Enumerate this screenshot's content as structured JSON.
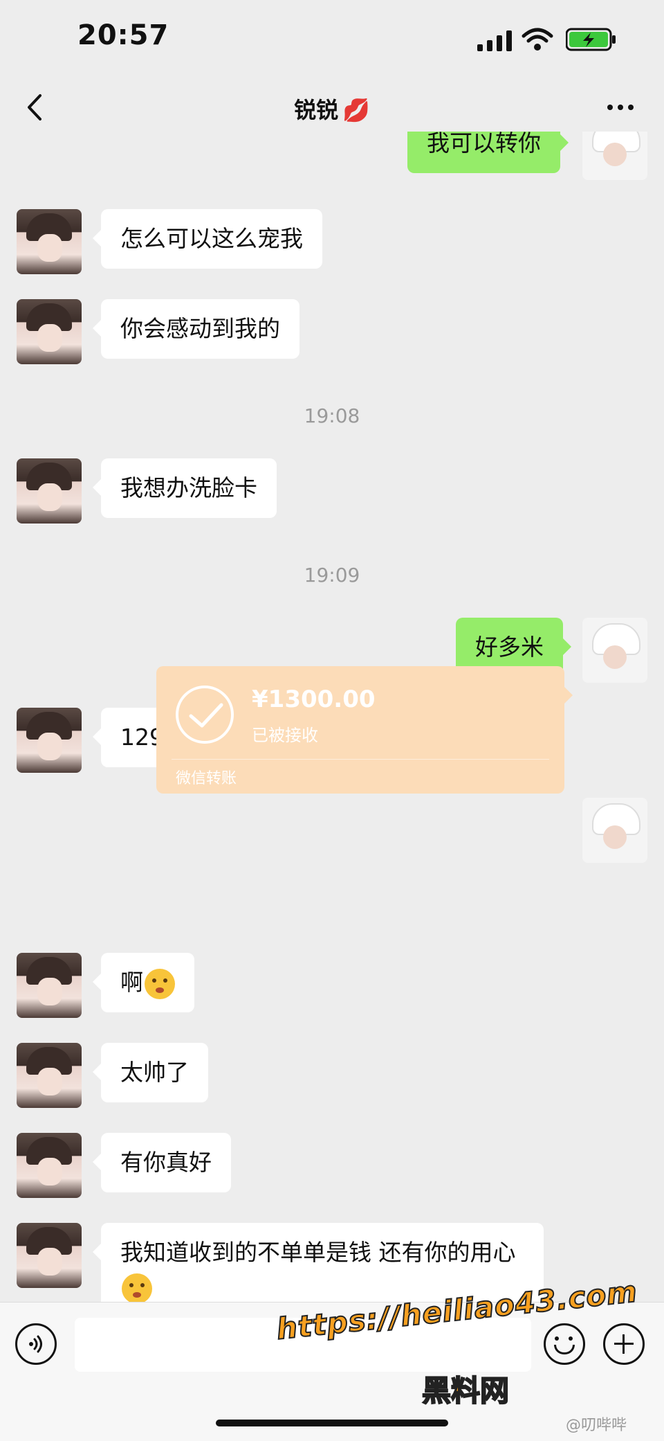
{
  "status_bar": {
    "time": "20:57"
  },
  "header": {
    "title": "锐锐",
    "title_emoji": "💋"
  },
  "messages": {
    "m0": "我可以转你",
    "m1": "怎么可以这么宠我",
    "m2": "你会感动到我的",
    "t1": "19:08",
    "m3": "我想办洗脸卡",
    "t2": "19:09",
    "m4": "好多米",
    "m5": "1299",
    "m6": "啊",
    "m7": "太帅了",
    "m8": "有你真好",
    "m9": "我知道收到的不单单是钱 还有你的用心"
  },
  "transfer": {
    "amount": "¥1300.00",
    "status": "已被接收",
    "footer": "微信转账"
  },
  "watermark": {
    "url": "https://heiliao43.com",
    "site": "黑料网",
    "weibo": "@叨哔哔"
  }
}
